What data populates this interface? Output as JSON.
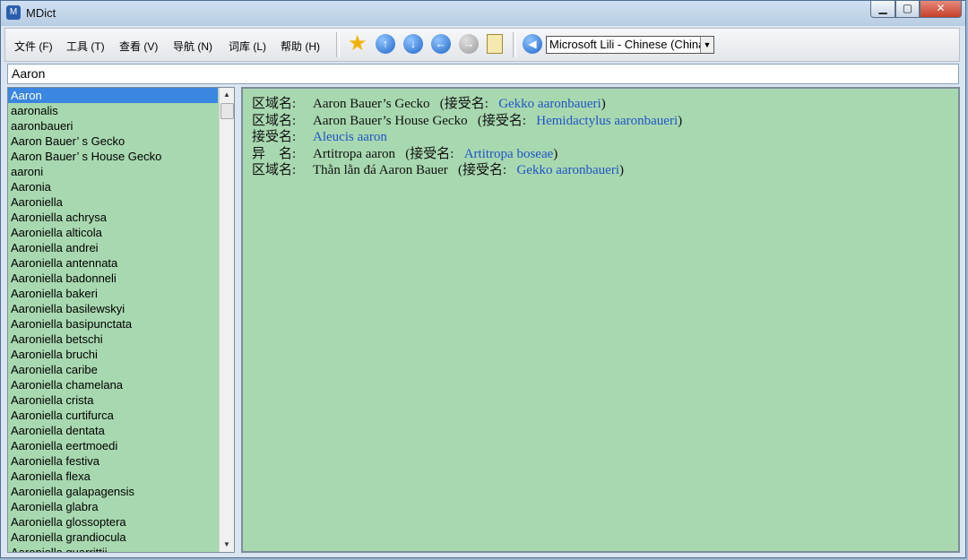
{
  "window": {
    "title": "MDict",
    "app_icon": "mdict-icon"
  },
  "menu": [
    "文件 (F)",
    "工具 (T)",
    "查看 (V)",
    "导航 (N)",
    "词库 (L)",
    "帮助 (H)"
  ],
  "voice": {
    "selected": "Microsoft Lili - Chinese (China)"
  },
  "search": {
    "value": "Aaron"
  },
  "word_list": [
    "Aaron",
    "aaronalis",
    "aaronbaueri",
    "Aaron Bauer’ s Gecko",
    "Aaron Bauer’ s House Gecko",
    "aaroni",
    "Aaronia",
    "Aaroniella",
    "Aaroniella achrysa",
    "Aaroniella alticola",
    "Aaroniella andrei",
    "Aaroniella antennata",
    "Aaroniella badonneli",
    "Aaroniella bakeri",
    "Aaroniella basilewskyi",
    "Aaroniella basipunctata",
    "Aaroniella betschi",
    "Aaroniella bruchi",
    "Aaroniella caribe",
    "Aaroniella chamelana",
    "Aaroniella crista",
    "Aaroniella curtifurca",
    "Aaroniella dentata",
    "Aaroniella eertmoedi",
    "Aaroniella festiva",
    "Aaroniella flexa",
    "Aaroniella galapagensis",
    "Aaroniella glabra",
    "Aaroniella glossoptera",
    "Aaroniella grandiocula",
    "Aaroniella guarrittii"
  ],
  "entries": [
    {
      "label": "区域名:",
      "term": "Aaron Bauer’s Gecko",
      "accepted_prefix": "(接受名:",
      "accepted": "Gekko aaronbaueri",
      "suffix": ")"
    },
    {
      "label": "区域名:",
      "term": "Aaron Bauer’s House Gecko",
      "accepted_prefix": "(接受名:",
      "accepted": "Hemidactylus aaronbaueri",
      "suffix": ")"
    },
    {
      "label": "接受名:",
      "term": "",
      "accepted_prefix": "",
      "accepted": "Aleucis aaron",
      "suffix": ""
    },
    {
      "label": "异　名:",
      "term": "Artitropa aaron",
      "accepted_prefix": "(接受名:",
      "accepted": "Artitropa boseae",
      "suffix": ")"
    },
    {
      "label": "区域名:",
      "term": "Thằn lằn đá Aaron Bauer",
      "accepted_prefix": "(接受名:",
      "accepted": "Gekko aaronbaueri",
      "suffix": ")"
    }
  ],
  "colors": {
    "panel_bg": "#a8d8b0",
    "link": "#1f55c4",
    "selection": "#3a86e0"
  }
}
